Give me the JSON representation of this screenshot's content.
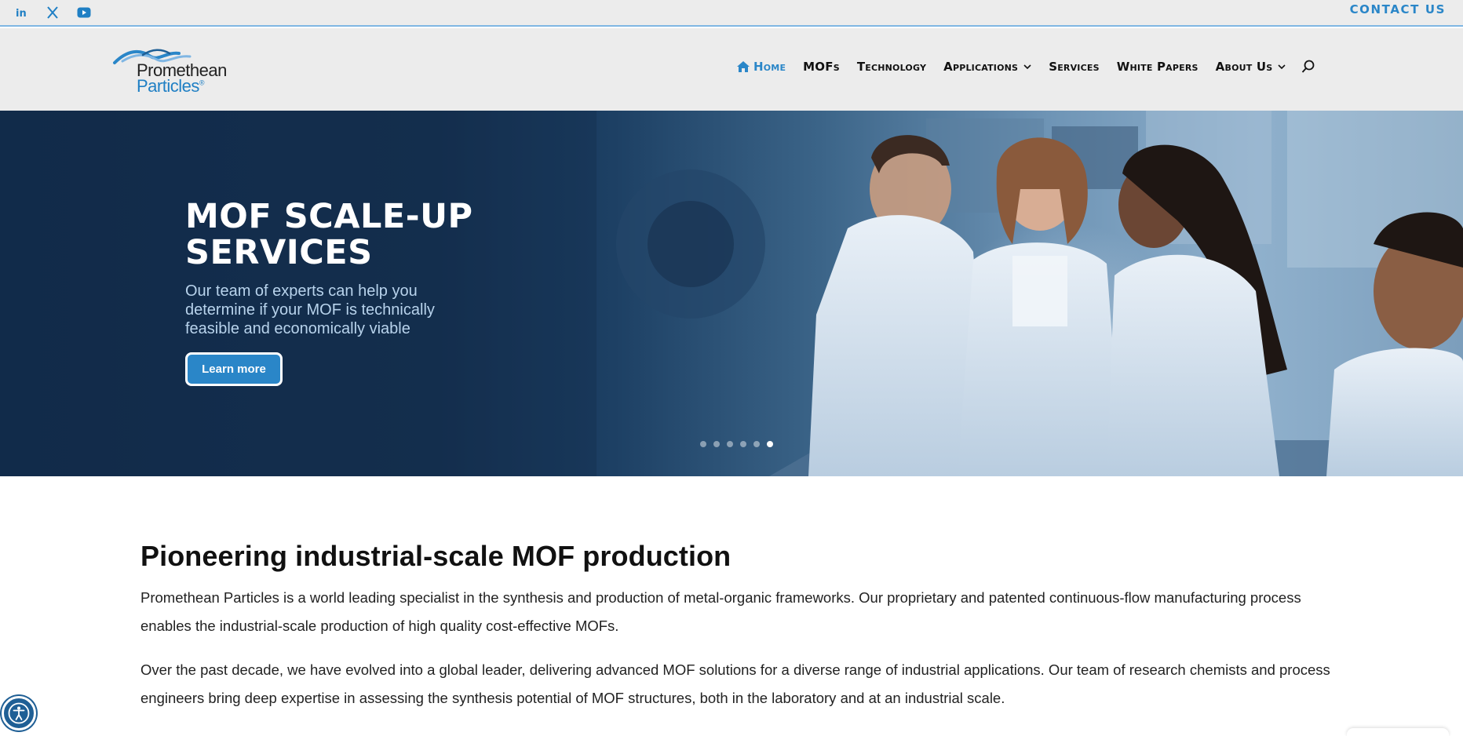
{
  "topbar": {
    "social": [
      {
        "name": "linkedin-icon",
        "glyph": "in"
      },
      {
        "name": "x-icon",
        "glyph": "𝕏"
      },
      {
        "name": "youtube-icon",
        "glyph": "▶"
      }
    ],
    "contact_label": "CONTACT US"
  },
  "header": {
    "logo": {
      "line1": "Promethean",
      "line2": "Particles",
      "mark": "®"
    },
    "nav": [
      {
        "label": "Home",
        "active": true,
        "has_home_icon": true,
        "has_dropdown": false
      },
      {
        "label": "MOFs",
        "active": false,
        "has_dropdown": false
      },
      {
        "label": "Technology",
        "active": false,
        "has_dropdown": false
      },
      {
        "label": "Applications",
        "active": false,
        "has_dropdown": true
      },
      {
        "label": "Services",
        "active": false,
        "has_dropdown": false
      },
      {
        "label": "White Papers",
        "active": false,
        "has_dropdown": false
      },
      {
        "label": "About Us",
        "active": false,
        "has_dropdown": true
      }
    ],
    "search_icon": "search-icon"
  },
  "hero": {
    "title": "MOF SCALE-UP SERVICES",
    "subtitle": "Our team of experts can help you determine if your MOF is technically feasible and economically viable",
    "button_label": "Learn more",
    "slide_count": 6,
    "active_slide": 6
  },
  "main": {
    "title": "Pioneering industrial-scale MOF production",
    "paragraphs": [
      "Promethean Particles is a world leading specialist in the synthesis and production of metal-organic frameworks. Our proprietary and patented continuous-flow manufacturing process enables the industrial-scale production of high quality cost-effective MOFs.",
      "Over the past decade, we have evolved into a global leader, delivering advanced MOF solutions for a diverse range of industrial applications. Our team of research chemists and process engineers bring deep expertise in assessing the synthesis potential of MOF structures, both in the laboratory and at an industrial scale."
    ]
  },
  "colors": {
    "accent": "#2a86c8",
    "hero_dark": "#122b4a",
    "topbar_bg": "#ececec",
    "a11y": "#1f5f95"
  }
}
